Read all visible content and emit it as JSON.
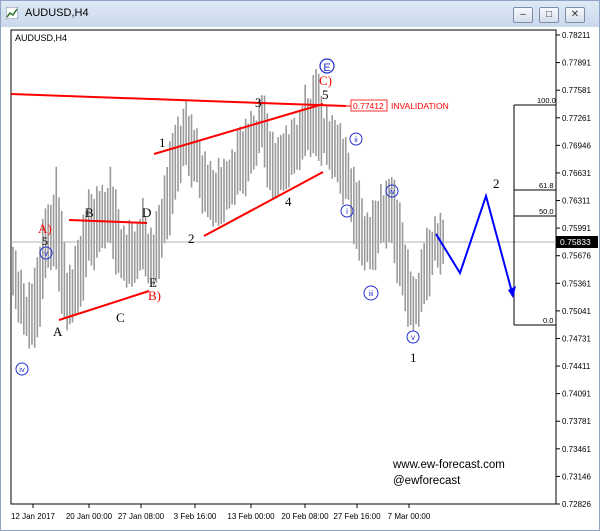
{
  "window": {
    "title": "AUDUSD,H4",
    "buttons": [
      {
        "name": "minimize-button",
        "glyph": "–"
      },
      {
        "name": "maximize-button",
        "glyph": "□"
      },
      {
        "name": "close-button",
        "glyph": "✕"
      }
    ]
  },
  "chart_data": {
    "type": "candlestick",
    "symbol_label": "AUDUSD,H4",
    "y_ticks": [
      "0.78211",
      "0.77891",
      "0.77581",
      "0.77261",
      "0.76946",
      "0.76631",
      "0.76311",
      "0.75991",
      "0.75676",
      "0.75361",
      "0.75041",
      "0.74731",
      "0.74411",
      "0.74091",
      "0.73781",
      "0.73461",
      "0.73146",
      "0.72826"
    ],
    "y_range": [
      0.72826,
      0.78211
    ],
    "x_ticks": [
      "12 Jan 2017",
      "20 Jan 00:00",
      "27 Jan 08:00",
      "3 Feb 16:00",
      "13 Feb 00:00",
      "20 Feb 08:00",
      "27 Feb 16:00",
      "7 Mar 00:00"
    ],
    "current_price": "0.75833",
    "invalidation": {
      "level": "0.77412",
      "text": "INVALIDATION"
    },
    "fib_levels": [
      "100.0",
      "61.8",
      "50.0",
      "0.0"
    ],
    "price_path": [
      [
        0.754,
        0.756
      ],
      [
        0.751,
        0.7495
      ],
      [
        0.748,
        0.752
      ],
      [
        0.756,
        0.76
      ],
      [
        0.764,
        0.757
      ],
      [
        0.753,
        0.75
      ],
      [
        0.752,
        0.756
      ],
      [
        0.758,
        0.761
      ],
      [
        0.759,
        0.762
      ],
      [
        0.764,
        0.76
      ],
      [
        0.758,
        0.756
      ],
      [
        0.755,
        0.758
      ],
      [
        0.76,
        0.757
      ],
      [
        0.755,
        0.757
      ],
      [
        0.76,
        0.763
      ],
      [
        0.765,
        0.77
      ],
      [
        0.772,
        0.769
      ],
      [
        0.768,
        0.767
      ],
      [
        0.765,
        0.763
      ],
      [
        0.762,
        0.765
      ],
      [
        0.766,
        0.764
      ],
      [
        0.766,
        0.769
      ],
      [
        0.768,
        0.77
      ],
      [
        0.773,
        0.771
      ],
      [
        0.768,
        0.765
      ],
      [
        0.766,
        0.769
      ],
      [
        0.77,
        0.768
      ],
      [
        0.77,
        0.773
      ],
      [
        0.776,
        0.77
      ],
      [
        0.769,
        0.771
      ],
      [
        0.77,
        0.767
      ],
      [
        0.766,
        0.765
      ],
      [
        0.762,
        0.758
      ],
      [
        0.757,
        0.759
      ],
      [
        0.76,
        0.762
      ],
      [
        0.764,
        0.76
      ],
      [
        0.758,
        0.754
      ],
      [
        0.751,
        0.75
      ],
      [
        0.753,
        0.756
      ],
      [
        0.758,
        0.7583
      ]
    ],
    "projection_label": "2",
    "wave_labels": [
      {
        "text": "A)",
        "style": "red"
      },
      {
        "text": "5",
        "style": "black"
      },
      {
        "text": "v",
        "style": "circle"
      },
      {
        "text": "iv",
        "style": "circle"
      },
      {
        "text": "A",
        "style": "black"
      },
      {
        "text": "B",
        "style": "black"
      },
      {
        "text": "C",
        "style": "black"
      },
      {
        "text": "D",
        "style": "black"
      },
      {
        "text": "E",
        "style": "black"
      },
      {
        "text": "B)",
        "style": "red"
      },
      {
        "text": "1",
        "style": "black"
      },
      {
        "text": "2",
        "style": "black"
      },
      {
        "text": "3",
        "style": "black"
      },
      {
        "text": "4",
        "style": "black"
      },
      {
        "text": "5",
        "style": "black"
      },
      {
        "text": "E",
        "style": "circle"
      },
      {
        "text": "C)",
        "style": "red"
      },
      {
        "text": "ii",
        "style": "circle"
      },
      {
        "text": "i",
        "style": "circle"
      },
      {
        "text": "iii",
        "style": "circle"
      },
      {
        "text": "iv",
        "style": "circle"
      },
      {
        "text": "v",
        "style": "circle"
      },
      {
        "text": "1",
        "style": "black"
      }
    ],
    "watermark": {
      "site": "www.ew-forecast.com",
      "handle": "@ewforecast"
    },
    "colors": {
      "trendline": "#ff0000",
      "projection": "#0000ff",
      "bars": "#9a9a9a",
      "circle": "#2030d0"
    }
  }
}
